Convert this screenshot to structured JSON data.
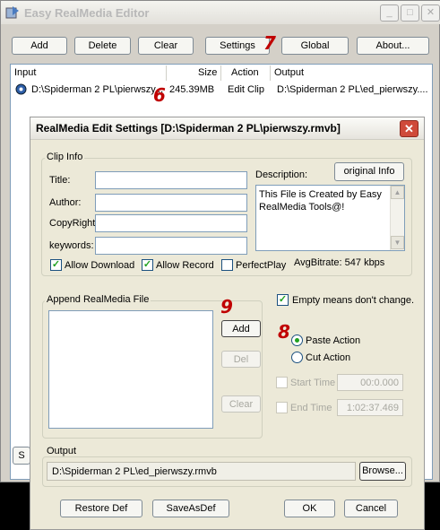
{
  "app": {
    "title": "Easy RealMedia Editor",
    "min_glyph": "_",
    "max_glyph": "□",
    "close_glyph": "✕"
  },
  "toolbar": {
    "add": "Add",
    "delete": "Delete",
    "clear": "Clear",
    "settings": "Settings",
    "global": "Global",
    "about": "About..."
  },
  "table": {
    "columns": [
      "Input",
      "Size",
      "Action",
      "Output"
    ],
    "rows": [
      {
        "input": "D:\\Spiderman 2 PL\\pierwszy...",
        "size": "245.39MB",
        "action": "Edit Clip",
        "output": "D:\\Spiderman 2 PL\\ed_pierwszy...."
      }
    ]
  },
  "bottom_left_button": "S",
  "markers": [
    "6",
    "7",
    "8",
    "9"
  ],
  "dialog": {
    "title": "RealMedia Edit Settings [D:\\Spiderman 2 PL\\pierwszy.rmvb]",
    "clip_info": {
      "group_label": "Clip Info",
      "title_label": "Title:",
      "author_label": "Author:",
      "copyright_label": "CopyRight",
      "keywords_label": "keywords:",
      "title_value": "",
      "author_value": "",
      "copyright_value": "",
      "keywords_value": "",
      "description_label": "Description:",
      "original_info_button": "original Info",
      "description_value": "This File is Created by Easy RealMedia Tools@!",
      "allow_download": "Allow Download",
      "allow_record": "Allow Record",
      "perfect_play": "PerfectPlay",
      "avg_bitrate": "AvgBitrate: 547 kbps"
    },
    "append": {
      "group_label": "Append RealMedia File",
      "add": "Add",
      "del": "Del",
      "clear": "Clear"
    },
    "empty_means": "Empty means don't change.",
    "paste_action": "Paste Action",
    "cut_action": "Cut Action",
    "start_time_label": "Start Time",
    "start_time_value": "00:0.000",
    "end_time_label": "End Time",
    "end_time_value": "1:02:37.469",
    "output": {
      "group_label": "Output",
      "path": "D:\\Spiderman 2 PL\\ed_pierwszy.rmvb",
      "browse": "Browse..."
    },
    "restore_def": "Restore Def",
    "save_as_def": "SaveAsDef",
    "ok": "OK",
    "cancel": "Cancel"
  }
}
